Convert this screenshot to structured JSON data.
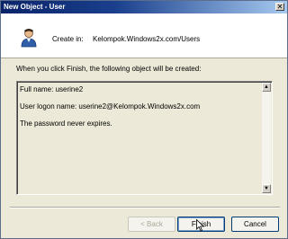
{
  "window": {
    "title": "New Object - User"
  },
  "header": {
    "create_in_label": "Create in:",
    "create_in_path": "Kelompok.Windows2x.com/Users"
  },
  "instruction": "When you click Finish, the following object will be created:",
  "summary": {
    "lines": [
      "Full name: userine2",
      "User logon name: userine2@Kelompok.Windows2x.com",
      "The password never expires."
    ]
  },
  "buttons": {
    "back": "< Back",
    "finish": "Finish",
    "cancel": "Cancel"
  },
  "icons": {
    "close": "close-icon",
    "user": "user-icon",
    "scroll_up": "scroll-up-arrow-icon",
    "scroll_down": "scroll-down-arrow-icon",
    "cursor": "mouse-pointer-icon"
  },
  "colors": {
    "titlebar_start": "#0a246a",
    "titlebar_end": "#a6caf0",
    "dialog_bg": "#ece9d8"
  }
}
